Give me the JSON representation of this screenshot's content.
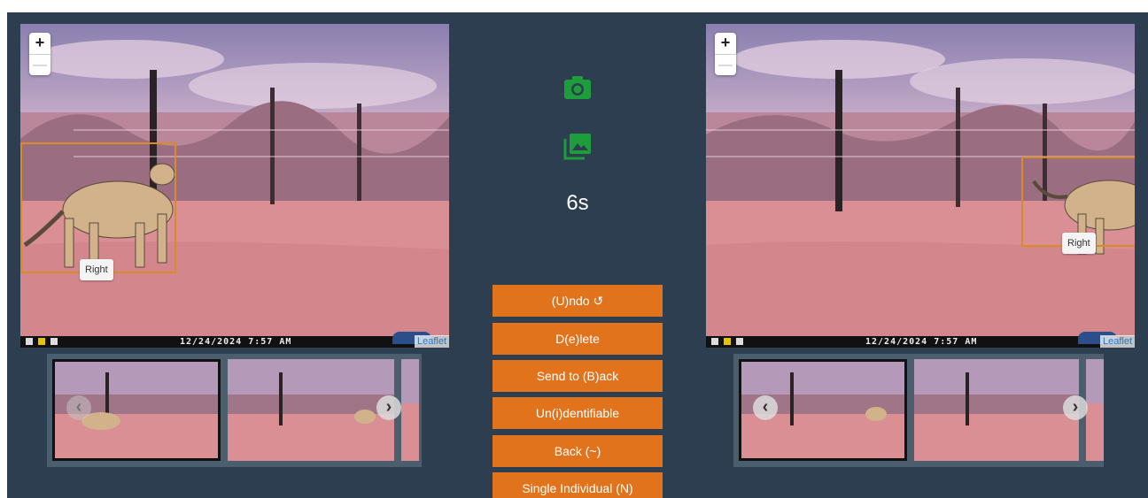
{
  "viewers": {
    "left": {
      "zoom_in": "+",
      "zoom_out": "—",
      "tag": "Right",
      "timestamp": "12/24/2024   7:57 AM",
      "attribution": "Leaflet"
    },
    "right": {
      "zoom_in": "+",
      "zoom_out": "—",
      "tag": "Right",
      "timestamp": "12/24/2024   7:57 AM",
      "attribution": "Leaflet"
    }
  },
  "strips": {
    "left": {
      "prev": "‹",
      "next": "›"
    },
    "right": {
      "prev": "‹",
      "next": "›"
    }
  },
  "center": {
    "timer": "6s",
    "icons": [
      "camera-icon",
      "photo-library-icon"
    ],
    "accent": "#1e9e3a",
    "buttons": {
      "undo": "(U)ndo ↺",
      "delete": "D(e)lete",
      "send_back": "Send to (B)ack",
      "unidentifiable": "Un(i)dentifiable",
      "back": "Back (~)",
      "single": "Single Individual (N)"
    }
  },
  "colors": {
    "background": "#2c3e50",
    "button": "#e0731b",
    "bbox": "#d98b2a"
  }
}
